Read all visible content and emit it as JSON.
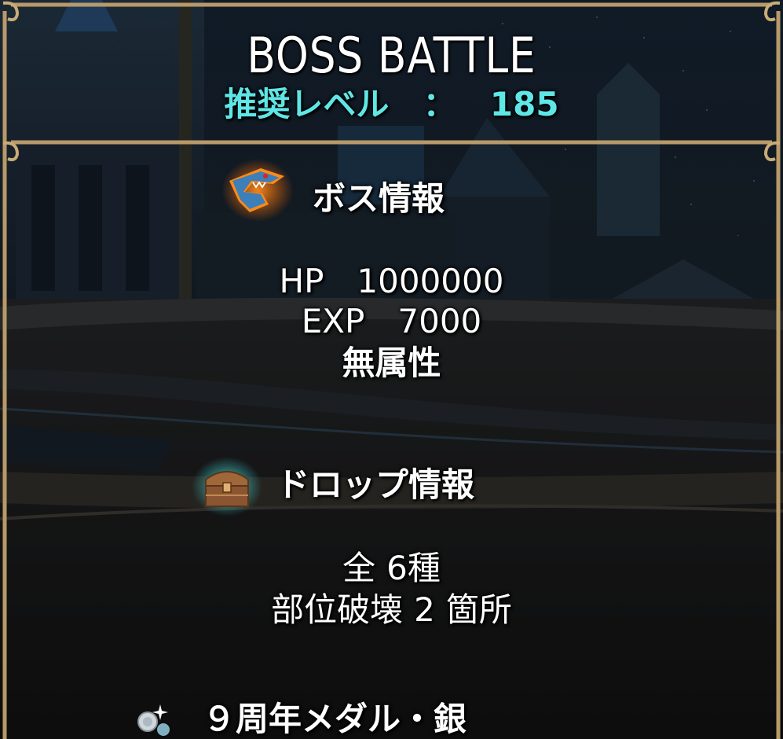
{
  "header": {
    "title": "BOSS BATTLE",
    "recommended_level_label": "推奨レベル",
    "separator": "：",
    "recommended_level": "185"
  },
  "boss_info": {
    "heading": "ボス情報",
    "icon": "shark-boss-icon",
    "hp_label": "HP",
    "hp_value": "1000000",
    "exp_label": "EXP",
    "exp_value": "7000",
    "attribute": "無属性"
  },
  "drop_info": {
    "heading": "ドロップ情報",
    "icon": "treasure-chest-icon",
    "total_prefix": "全",
    "total_value": "6種",
    "break_label": "部位破壊",
    "break_count": "2",
    "break_suffix": "箇所"
  },
  "rewards": [
    {
      "icon": "silver-medal-icon",
      "label": "９周年メダル・銀"
    }
  ],
  "colors": {
    "level_text": "#5fe6e6",
    "frame_bronze": "#b89a6a",
    "text": "#ffffff"
  }
}
